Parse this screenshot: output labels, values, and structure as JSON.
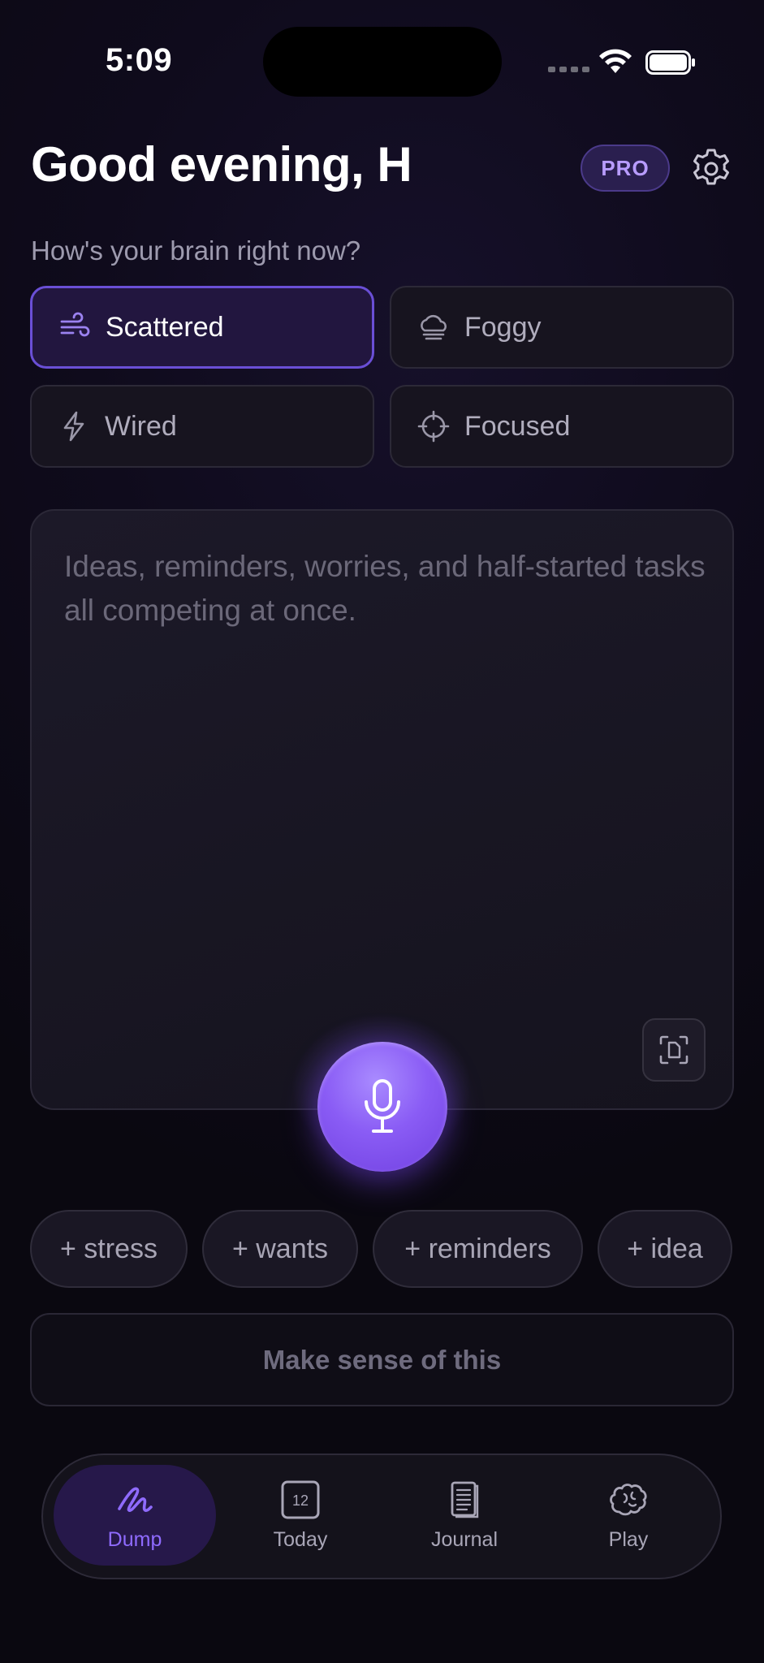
{
  "status_bar": {
    "time": "5:09"
  },
  "header": {
    "greeting": "Good evening, H",
    "badge": "PRO"
  },
  "mood": {
    "prompt": "How's your brain right now?",
    "options": [
      {
        "label": "Scattered",
        "icon": "wind-icon",
        "selected": true
      },
      {
        "label": "Foggy",
        "icon": "cloud-fog-icon",
        "selected": false
      },
      {
        "label": "Wired",
        "icon": "lightning-icon",
        "selected": false
      },
      {
        "label": "Focused",
        "icon": "crosshair-icon",
        "selected": false
      }
    ]
  },
  "dump": {
    "placeholder": "Ideas, reminders, worries, and half-started tasks all competing at once.",
    "value": ""
  },
  "chips": [
    "+ stress",
    "+ wants",
    "+ reminders",
    "+ idea"
  ],
  "action": {
    "label": "Make sense of this"
  },
  "tabs": [
    {
      "label": "Dump",
      "icon": "scribble-icon",
      "active": true
    },
    {
      "label": "Today",
      "icon": "calendar-icon",
      "active": false,
      "icon_text": "12"
    },
    {
      "label": "Journal",
      "icon": "notebook-icon",
      "active": false
    },
    {
      "label": "Play",
      "icon": "brain-icon",
      "active": false
    }
  ],
  "colors": {
    "accent": "#8f6bff",
    "selected_border": "#6a4fd6",
    "background": "#0f0b1c"
  }
}
